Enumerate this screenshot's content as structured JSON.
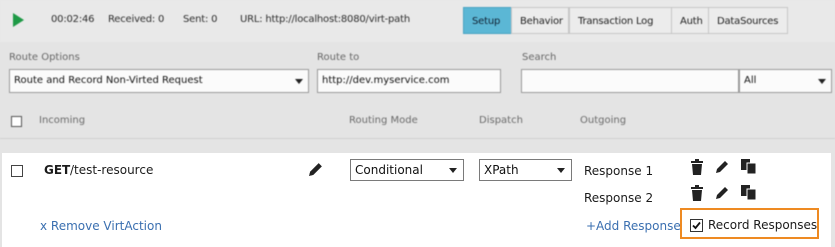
{
  "toolbar": {
    "timer": "00:02:46",
    "received": "Received: 0",
    "sent": "Sent: 0",
    "url": "URL: http://localhost:8080/virt-path",
    "tabs": [
      "Setup",
      "Behavior",
      "Transaction Log",
      "Auth",
      "DataSources"
    ],
    "active_tab": "Setup"
  },
  "filters": {
    "route_options_label": "Route Options",
    "route_options_value": "Route and Record Non-Virted Request",
    "route_to_label": "Route to",
    "route_to_value": "http://dev.myservice.com",
    "search_label": "Search",
    "search_value": "",
    "search_scope": "All"
  },
  "columns": {
    "incoming": "Incoming",
    "routing_mode": "Routing Mode",
    "dispatch": "Dispatch",
    "outgoing": "Outgoing"
  },
  "row": {
    "method": "GET",
    "path": "/test-resource",
    "routing_mode": "Conditional",
    "dispatch": "XPath",
    "responses": [
      "Response 1",
      "Response 2"
    ],
    "remove_link": "x Remove VirtAction",
    "add_response_link": "+Add Response",
    "record_responses_label": "Record Responses",
    "record_responses_checked": true
  },
  "colors": {
    "play": "#1e9a46",
    "active_tab": "#5bb7d5",
    "link": "#3a6fb0",
    "highlight": "#ee8a22"
  }
}
